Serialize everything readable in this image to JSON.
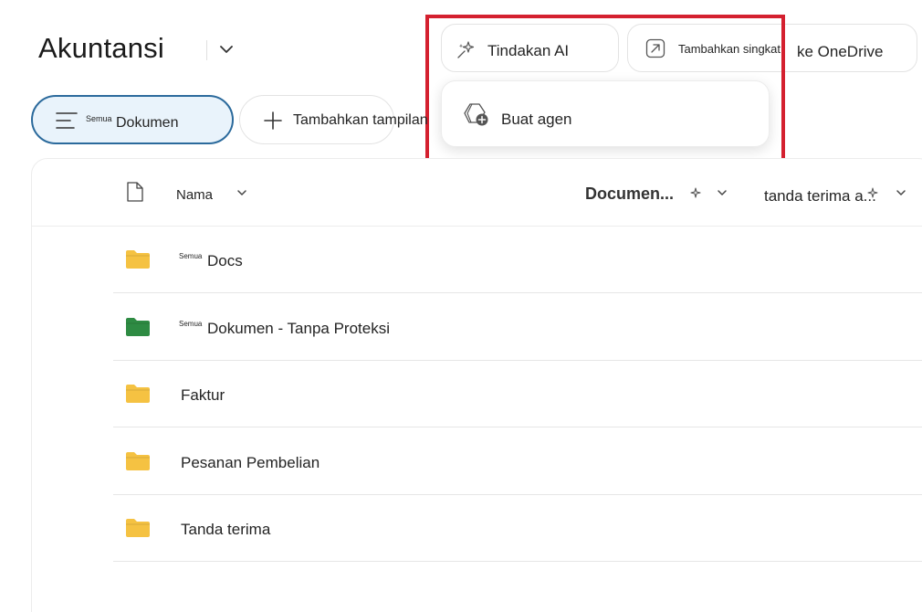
{
  "page": {
    "title": "Akuntansi"
  },
  "toolbar": {
    "ai_actions_label": "Tindakan AI",
    "shortcut_label_a": "Tambahkan singkat",
    "shortcut_label_b": "ke OneDrive"
  },
  "dropdown": {
    "create_agent_label": "Buat agen"
  },
  "views": {
    "current_prefix": "Semua",
    "current_label": "Dokumen",
    "add_view_label": "Tambahkan tampilan"
  },
  "columns": {
    "name": "Nama",
    "document": "Documen...",
    "receipt": "tanda terima a..."
  },
  "rows": [
    {
      "prefix": "Semua",
      "name": "Docs",
      "folder_color": "#f5c242"
    },
    {
      "prefix": "Semua",
      "name": "Dokumen - Tanpa Proteksi",
      "folder_color": "#2e8b43"
    },
    {
      "prefix": "",
      "name": "Faktur",
      "folder_color": "#f5c242"
    },
    {
      "prefix": "",
      "name": "Pesanan Pembelian",
      "folder_color": "#f5c242"
    },
    {
      "prefix": "",
      "name": "Tanda terima",
      "folder_color": "#f5c242"
    }
  ],
  "colors": {
    "accent": "#2b6a9c",
    "highlight": "#d4202f"
  }
}
